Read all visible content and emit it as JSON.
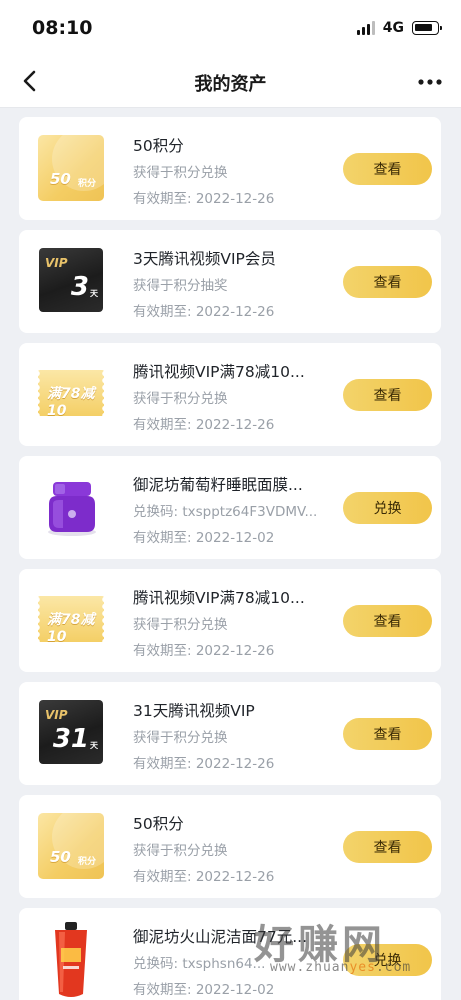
{
  "status_bar": {
    "time": "08:10",
    "network": "4G"
  },
  "header": {
    "title": "我的资产"
  },
  "assets": [
    {
      "thumb": "points",
      "thumb_text": "50",
      "thumb_unit": "积分",
      "title": "50积分",
      "source": "获得于积分兑换",
      "expiry": "有效期至: 2022-12-26",
      "button": "查看"
    },
    {
      "thumb": "vip",
      "thumb_text": "3",
      "thumb_unit": "天",
      "thumb_label": "VIP",
      "title": "3天腾讯视频VIP会员",
      "source": "获得于积分抽奖",
      "expiry": "有效期至: 2022-12-26",
      "button": "查看"
    },
    {
      "thumb": "coupon",
      "thumb_text": "满78减10",
      "title": "腾讯视频VIP满78减10...",
      "source": "获得于积分兑换",
      "expiry": "有效期至: 2022-12-26",
      "button": "查看"
    },
    {
      "thumb": "jar",
      "title": "御泥坊葡萄籽睡眠面膜...",
      "source": "兑换码: txspptz64F3VDMV...",
      "expiry": "有效期至: 2022-12-02",
      "button": "兑换"
    },
    {
      "thumb": "coupon",
      "thumb_text": "满78减10",
      "title": "腾讯视频VIP满78减10...",
      "source": "获得于积分兑换",
      "expiry": "有效期至: 2022-12-26",
      "button": "查看"
    },
    {
      "thumb": "vip",
      "thumb_text": "31",
      "thumb_unit": "天",
      "thumb_label": "VIP",
      "title": "31天腾讯视频VIP",
      "source": "获得于积分兑换",
      "expiry": "有效期至: 2022-12-26",
      "button": "查看"
    },
    {
      "thumb": "points",
      "thumb_text": "50",
      "thumb_unit": "积分",
      "title": "50积分",
      "source": "获得于积分兑换",
      "expiry": "有效期至: 2022-12-26",
      "button": "查看"
    },
    {
      "thumb": "tube",
      "title": "御泥坊火山泥洁面77元...",
      "source": "兑换码: txsphsn64...",
      "expiry": "有效期至: 2022-12-02",
      "button": "兑换"
    }
  ],
  "watermark": {
    "text": "好赚网",
    "url_prefix": "www.zhuan",
    "url_accent": "yes",
    "url_suffix": ".com"
  },
  "colors": {
    "button_gold": "#f1c54a",
    "page_bg": "#eef0f4",
    "muted_text": "#9aa0a8"
  }
}
